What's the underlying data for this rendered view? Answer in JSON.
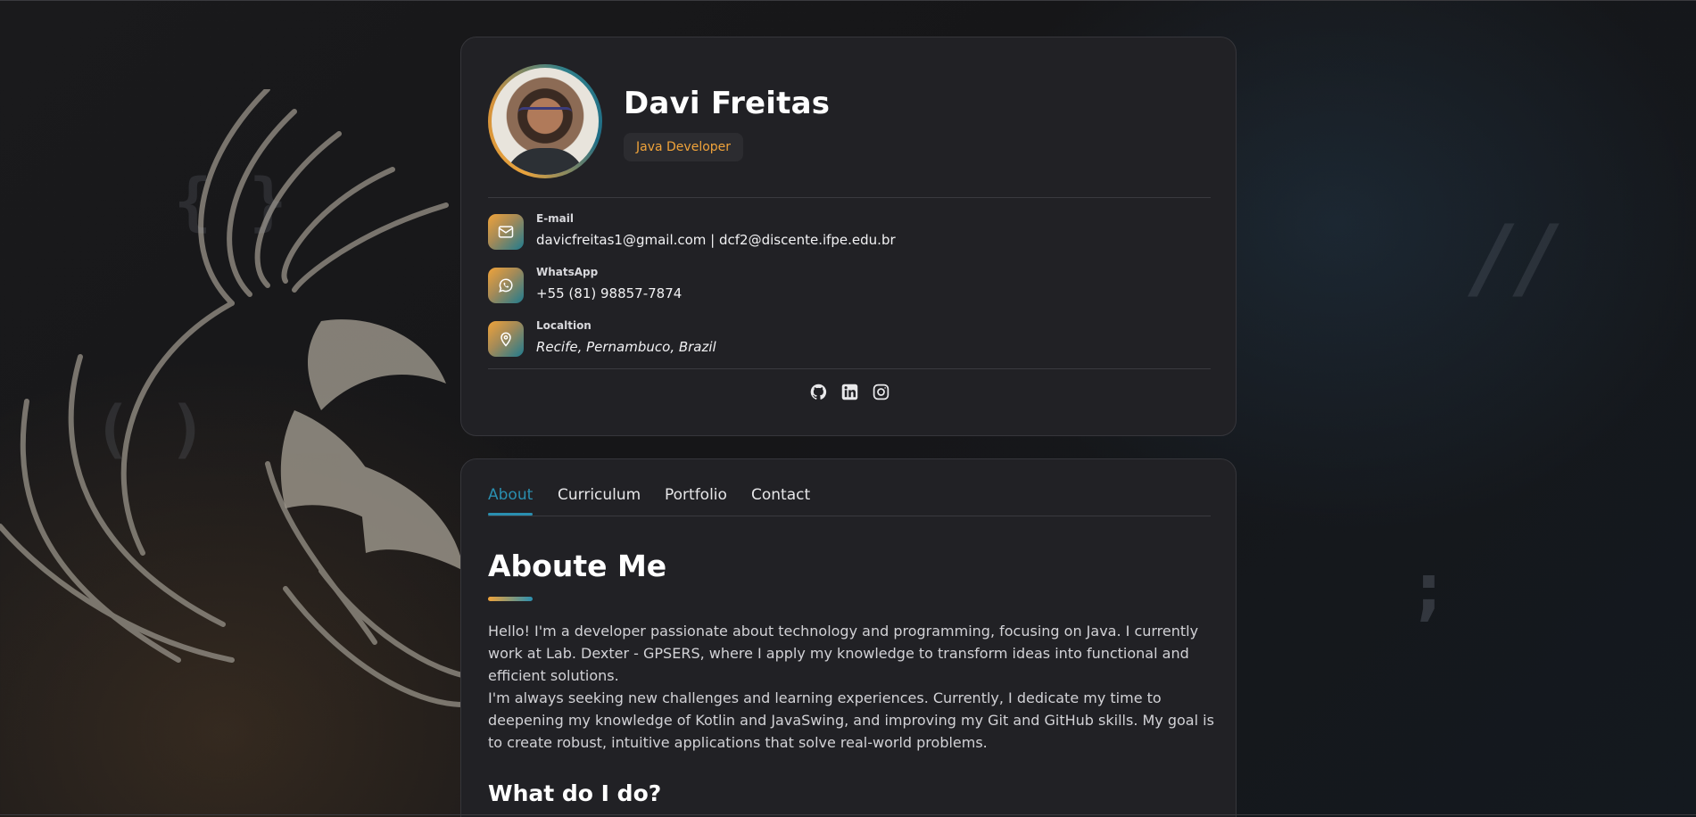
{
  "profile": {
    "name": "Davi Freitas",
    "role": "Java Developer",
    "contacts": [
      {
        "label": "E-mail",
        "value": "davicfreitas1@gmail.com | dcf2@discente.ifpe.edu.br",
        "icon": "mail-icon"
      },
      {
        "label": "WhatsApp",
        "value": "+55 (81) 98857-7874",
        "icon": "whatsapp-icon"
      },
      {
        "label": "Localtion",
        "value": "Recife, Pernambuco, Brazil",
        "icon": "location-pin-icon"
      }
    ],
    "socials": [
      "github-icon",
      "linkedin-icon",
      "instagram-icon"
    ]
  },
  "nav": {
    "tabs": [
      {
        "label": "About",
        "active": true
      },
      {
        "label": "Curriculum",
        "active": false
      },
      {
        "label": "Portfolio",
        "active": false
      },
      {
        "label": "Contact",
        "active": false
      }
    ]
  },
  "about": {
    "title": "Aboute Me",
    "paragraphs": [
      "Hello! I'm a developer passionate about technology and programming, focusing on Java. I currently work at Lab. Dexter - GPSERS, where I apply my knowledge to transform ideas into functional and efficient solutions.",
      "I'm always seeking new challenges and learning experiences. Currently, I dedicate my time to deepening my knowledge of Kotlin and JavaSwing, and improving my Git and GitHub skills. My goal is to create robust, intuitive applications that solve real-world problems."
    ],
    "subheading": "What do I do?"
  },
  "decor": {
    "braces": "{ }",
    "parens": "( )",
    "slashes": "//",
    "semicolon": ";"
  },
  "colors": {
    "accent_orange": "#f0a33a",
    "accent_blue": "#2a8fb0",
    "card_bg": "#212125"
  }
}
